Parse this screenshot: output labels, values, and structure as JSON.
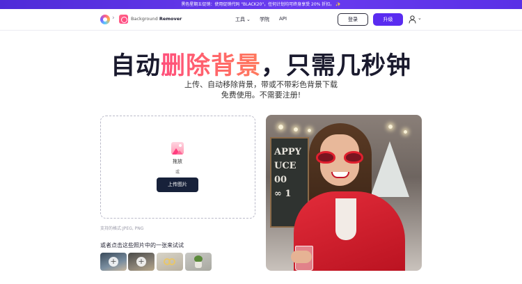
{
  "promo": {
    "text": "黑色星期五促销：使用促销代码 \"BLACK20\"，任何计划均可终身享受 20% 折扣。 ✨"
  },
  "header": {
    "app_name_prefix": "Background",
    "app_name_bold": "Remover",
    "crumb_separator": "›",
    "nav": {
      "tools": "工具",
      "learn": "学院",
      "api": "API"
    },
    "login_label": "登录",
    "upgrade_label": "升级",
    "chevron": "⌄"
  },
  "hero": {
    "headline_part1": "自动",
    "headline_accent": "删除背景",
    "headline_part2": "，只需几秒钟",
    "subtitle_line1": "上传、自动移除背景，带或不带彩色背景下载",
    "subtitle_line2": "免费使用。不需要注册!"
  },
  "upload": {
    "drag_text": "拖放",
    "or_text": "或",
    "button_label": "上传图片",
    "formats_text": "支持的格式:JPEG, PNG"
  },
  "samples": {
    "prompt": "或者点击这些照片中的一张来试试",
    "plus": "+"
  },
  "photo": {
    "board_text": "APPY\nUCE\n00\n∞ 1"
  },
  "colors": {
    "promo_bg": "#5a30e6",
    "upgrade_bg": "#5a2cf0",
    "upload_bg": "#17213a",
    "accent_start": "#ff4f7b",
    "accent_end": "#ff7a5c"
  }
}
